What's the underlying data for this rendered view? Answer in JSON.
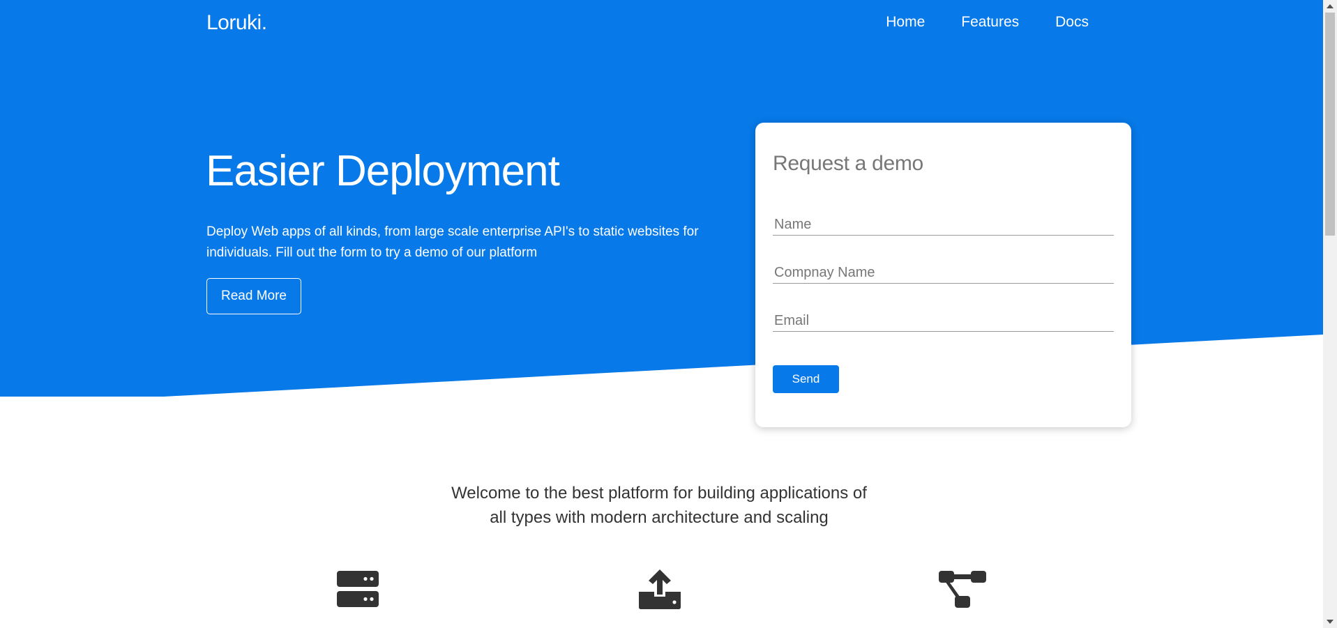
{
  "colors": {
    "primary": "#0779e9",
    "white": "#ffffff",
    "text_dark": "#333333",
    "placeholder": "#777777",
    "icon": "#333333"
  },
  "header": {
    "logo": "Loruki.",
    "nav": [
      {
        "label": "Home"
      },
      {
        "label": "Features"
      },
      {
        "label": "Docs"
      }
    ]
  },
  "hero": {
    "title": "Easier Deployment",
    "text": "Deploy Web apps of all kinds, from large scale enterprise API's to static websites for individuals. Fill out the form to try a demo of our platform",
    "button_label": "Read More"
  },
  "demo_form": {
    "title": "Request a demo",
    "fields": [
      {
        "placeholder": "Name",
        "value": ""
      },
      {
        "placeholder": "Compnay Name",
        "value": ""
      },
      {
        "placeholder": "Email",
        "value": ""
      }
    ],
    "submit_label": "Send"
  },
  "intro": {
    "text": "Welcome to the best platform for building applications of all types with modern architecture and scaling"
  },
  "features": {
    "icons": [
      "server-icon",
      "upload-icon",
      "network-icon"
    ]
  }
}
